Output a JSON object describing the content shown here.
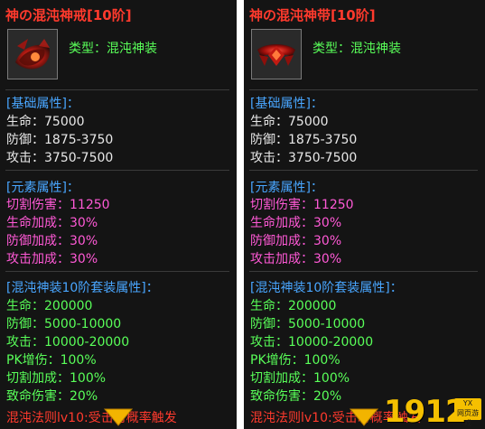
{
  "left": {
    "title": "神の混沌神戒[10阶]",
    "type_label": "类型：混沌神装",
    "base": {
      "header": "[基础属性]：",
      "hp": "生命：75000",
      "def": "防御：1875-3750",
      "atk": "攻击：3750-7500"
    },
    "element": {
      "header": "[元素属性]：",
      "l1": "切割伤害：11250",
      "l2": "生命加成：30%",
      "l3": "防御加成：30%",
      "l4": "攻击加成：30%"
    },
    "set": {
      "header": "[混沌神装10阶套装属性]：",
      "l1": "生命：200000",
      "l2": "防御：5000-10000",
      "l3": "攻击：10000-20000",
      "l4": "PK增伤：100%",
      "l5": "切割加成：100%",
      "l6": "致命伤害：20%",
      "l7": "混沌法则lv10:受击时概率触发"
    },
    "icon": "red-ring-icon"
  },
  "right": {
    "title": "神の混沌神带[10阶]",
    "type_label": "类型：混沌神装",
    "base": {
      "header": "[基础属性]：",
      "hp": "生命：75000",
      "def": "防御：1875-3750",
      "atk": "攻击：3750-7500"
    },
    "element": {
      "header": "[元素属性]：",
      "l1": "切割伤害：11250",
      "l2": "生命加成：30%",
      "l3": "防御加成：30%",
      "l4": "攻击加成：30%"
    },
    "set": {
      "header": "[混沌神装10阶套装属性]：",
      "l1": "生命：200000",
      "l2": "防御：5000-10000",
      "l3": "攻击：10000-20000",
      "l4": "PK增伤：100%",
      "l5": "切割加成：100%",
      "l6": "致命伤害：20%",
      "l7": "混沌法则lv10:受击时概率触发"
    },
    "icon": "red-belt-icon"
  },
  "watermark": {
    "number": "1912",
    "box_top": "YX",
    "box_bottom": "网页游戏"
  },
  "colors": {
    "title_red": "#ff3a2d",
    "type_green": "#59ff59",
    "section_blue": "#49a6ff",
    "element_pink": "#ff59d6",
    "base_white": "#e8e8e8",
    "arrow_gold": "#f2b400"
  }
}
